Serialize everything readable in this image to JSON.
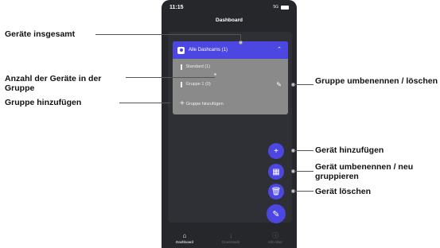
{
  "status": {
    "time": "11:15",
    "network": "5G"
  },
  "header": {
    "title": "Dashboard"
  },
  "groups": {
    "all_label": "Alle Dashcams (1)",
    "items": [
      {
        "label": "Standard (1)"
      },
      {
        "label": "Gruppe 1 (0)"
      }
    ],
    "add_label": "Gruppe hinzufügen"
  },
  "nav": {
    "items": [
      {
        "label": "Dashboard",
        "icon": "home-icon"
      },
      {
        "label": "Downloads",
        "icon": "download-icon"
      },
      {
        "label": "Info über",
        "icon": "info-icon"
      }
    ]
  },
  "annotations": {
    "total_devices": "Geräte insgesamt",
    "devices_in_group": "Anzahl der Geräte in der Gruppe",
    "add_group": "Gruppe hinzufügen",
    "rename_group": "Gruppe umbenennen / löschen",
    "add_device": "Gerät hinzufügen",
    "rename_device": "Gerät umbenennen / neu gruppieren",
    "delete_device": "Gerät löschen"
  },
  "colors": {
    "accent": "#4b47e0",
    "panel": "#8a8a8a",
    "background": "#26272b"
  }
}
